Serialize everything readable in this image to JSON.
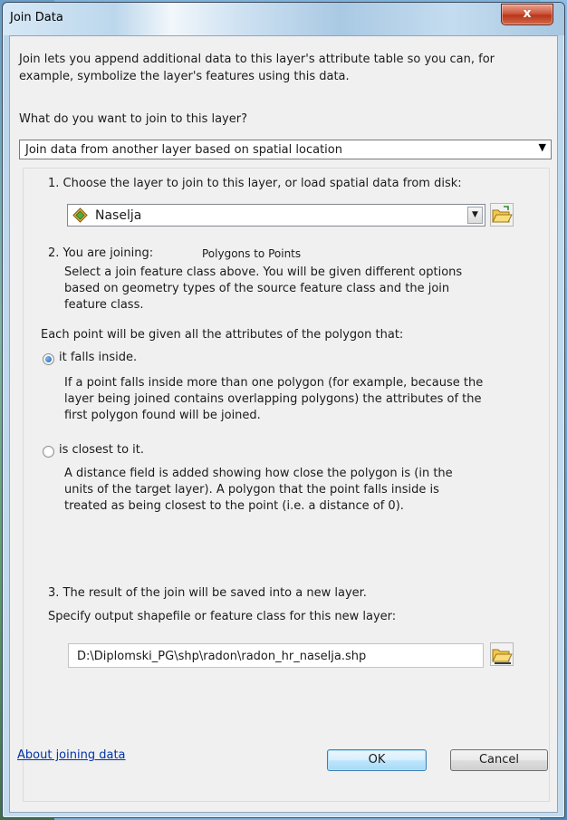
{
  "window": {
    "title": "Join Data",
    "close_glyph": "x"
  },
  "intro": "Join lets you append additional data to this layer's attribute table so you can, for example, symbolize the layer's features using this data.",
  "question": "What do you want to join to this layer?",
  "join_type": {
    "selected": "Join data from another layer based on spatial location"
  },
  "step1": {
    "label": "1. Choose the layer to join to this layer, or load spatial data from disk:",
    "layer_selected": "Naselja"
  },
  "step2": {
    "label": "2. You are joining:",
    "join_kind": "Polygons to Points",
    "description": "Select a join feature class above.  You will be given different options based on geometry types of the source feature class and the join feature class.",
    "each_point": "Each point will be given all the attributes of the polygon that:",
    "option_inside": {
      "label": "it falls inside.",
      "description": "If a point falls inside more than one polygon (for example, because the layer being joined contains overlapping polygons) the attributes of the first polygon found will be joined.",
      "selected": true
    },
    "option_closest": {
      "label": "is closest to it.",
      "description": "A distance field is added showing how close the polygon is (in the units of the target layer). A polygon that the point falls inside is treated as being closest to the point (i.e. a distance of 0).",
      "selected": false
    }
  },
  "step3": {
    "label": "3. The result of the join will be saved into a new layer.",
    "specify": "Specify output shapefile or feature class for this new layer:",
    "output_path": "D:\\Diplomski_PG\\shp\\radon\\radon_hr_naselja.shp"
  },
  "footer": {
    "help_link": "About joining data",
    "ok_label": "OK",
    "cancel_label": "Cancel"
  }
}
